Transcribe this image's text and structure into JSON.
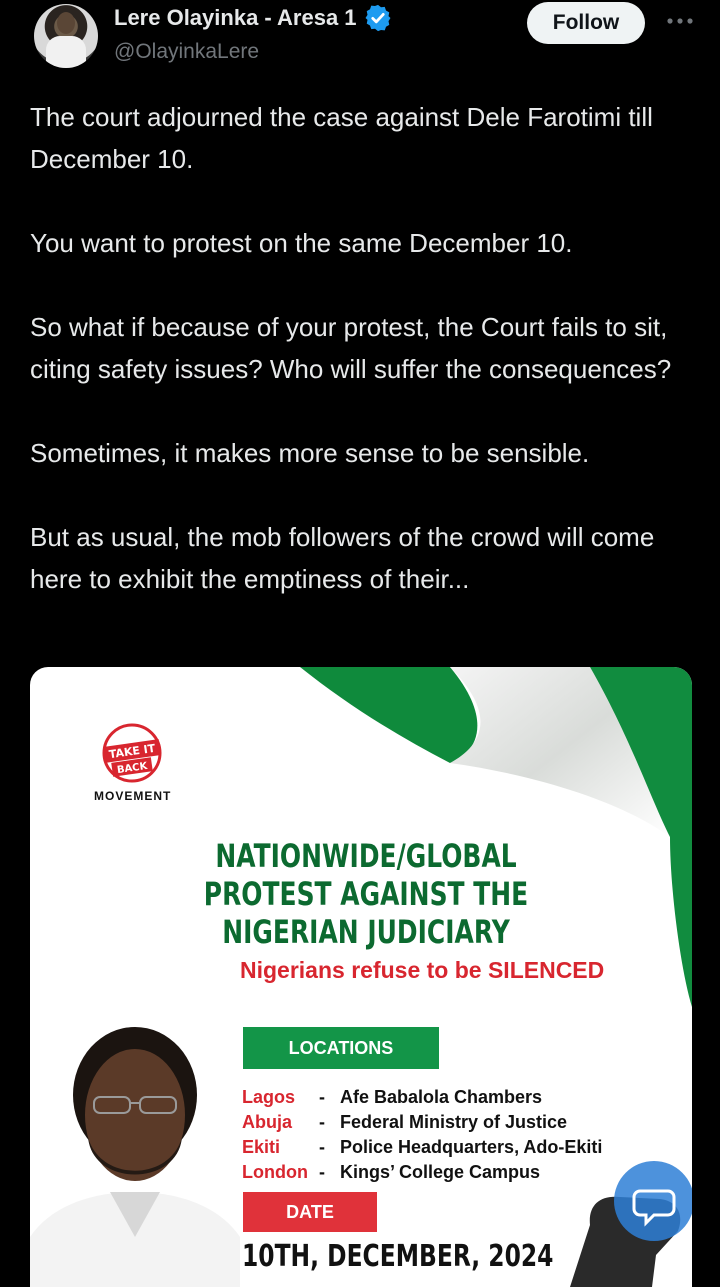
{
  "header": {
    "display_name": "Lere Olayinka - Aresa 1",
    "handle": "@OlayinkaLere",
    "follow_label": "Follow"
  },
  "tweet": {
    "paragraphs": [
      "The court adjourned the case against Dele Farotimi till December 10.",
      "You want to protest on the same December 10.",
      "So what if because of your protest, the Court fails to sit, citing safety issues? Who will suffer the consequences?",
      "Sometimes, it makes more sense to be sensible.",
      "But as usual, the mob followers of the crowd will come here to exhibit the emptiness of their..."
    ]
  },
  "media": {
    "logo_lines": [
      "TAKE IT",
      "BACK"
    ],
    "logo_caption": "MOVEMENT",
    "title": "NATIONWIDE/GLOBAL PROTEST AGAINST THE NIGERIAN JUDICIARY",
    "refuse_text": "Nigerians refuse to be SILENCED",
    "locations_label": "LOCATIONS",
    "locations": [
      {
        "city": "Lagos",
        "place": "Afe Babalola Chambers"
      },
      {
        "city": "Abuja",
        "place": "Federal Ministry of Justice"
      },
      {
        "city": "Ekiti",
        "place": "Police Headquarters, Ado-Ekiti"
      },
      {
        "city": "London",
        "place": "Kings’ College Campus"
      }
    ],
    "date_label": "DATE",
    "date_value": "10TH, DECEMBER, 2024"
  },
  "colors": {
    "background": "#000000",
    "flag_green": "#0f8a3c",
    "title_green": "#0c6a30",
    "accent_red": "#d8262f",
    "verified_blue": "#1d9bf0"
  },
  "icons": {
    "verified": "verified-badge-icon",
    "more": "more-horizontal-icon"
  }
}
